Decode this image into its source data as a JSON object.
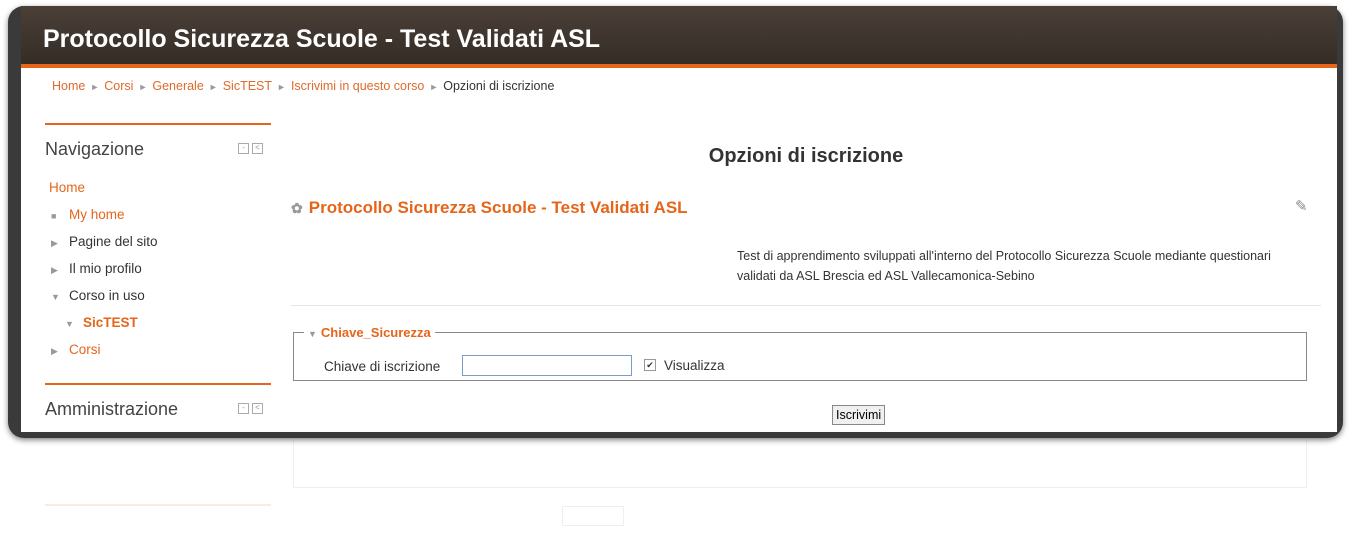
{
  "site": {
    "title": "Protocollo Sicurezza Scuole - Test Validati ASL"
  },
  "breadcrumb": {
    "items": [
      "Home",
      "Corsi",
      "Generale",
      "SicTEST",
      "Iscrivimi in questo corso"
    ],
    "current": "Opzioni di iscrizione",
    "separator": "►"
  },
  "navigation": {
    "title": "Navigazione",
    "items": [
      {
        "label": "Home"
      },
      {
        "label": "My home",
        "marker": "■"
      },
      {
        "label": "Pagine del sito",
        "marker": "▶"
      },
      {
        "label": "Il mio profilo",
        "marker": "▶"
      },
      {
        "label": "Corso in uso",
        "marker": "▼"
      },
      {
        "label": "SicTEST",
        "marker": "▼"
      },
      {
        "label": "Corsi",
        "marker": "▶"
      }
    ]
  },
  "administration": {
    "title": "Amministrazione"
  },
  "main": {
    "page_title": "Opzioni di iscrizione",
    "course_title": "Protocollo Sicurezza Scuole - Test Validati ASL",
    "course_description": "Test di apprendimento sviluppati all'interno del Protocollo Sicurezza Scuole mediante questionari validati da ASL Brescia ed ASL Vallecamonica-Sebino",
    "fieldset_legend": "Chiave_Sicurezza",
    "key_label": "Chiave di iscrizione",
    "key_value": "",
    "show_label": "Visualizza",
    "submit_label": "Iscrivimi"
  },
  "colors": {
    "accent": "#e5651a",
    "header_bg": "#3f362f"
  }
}
